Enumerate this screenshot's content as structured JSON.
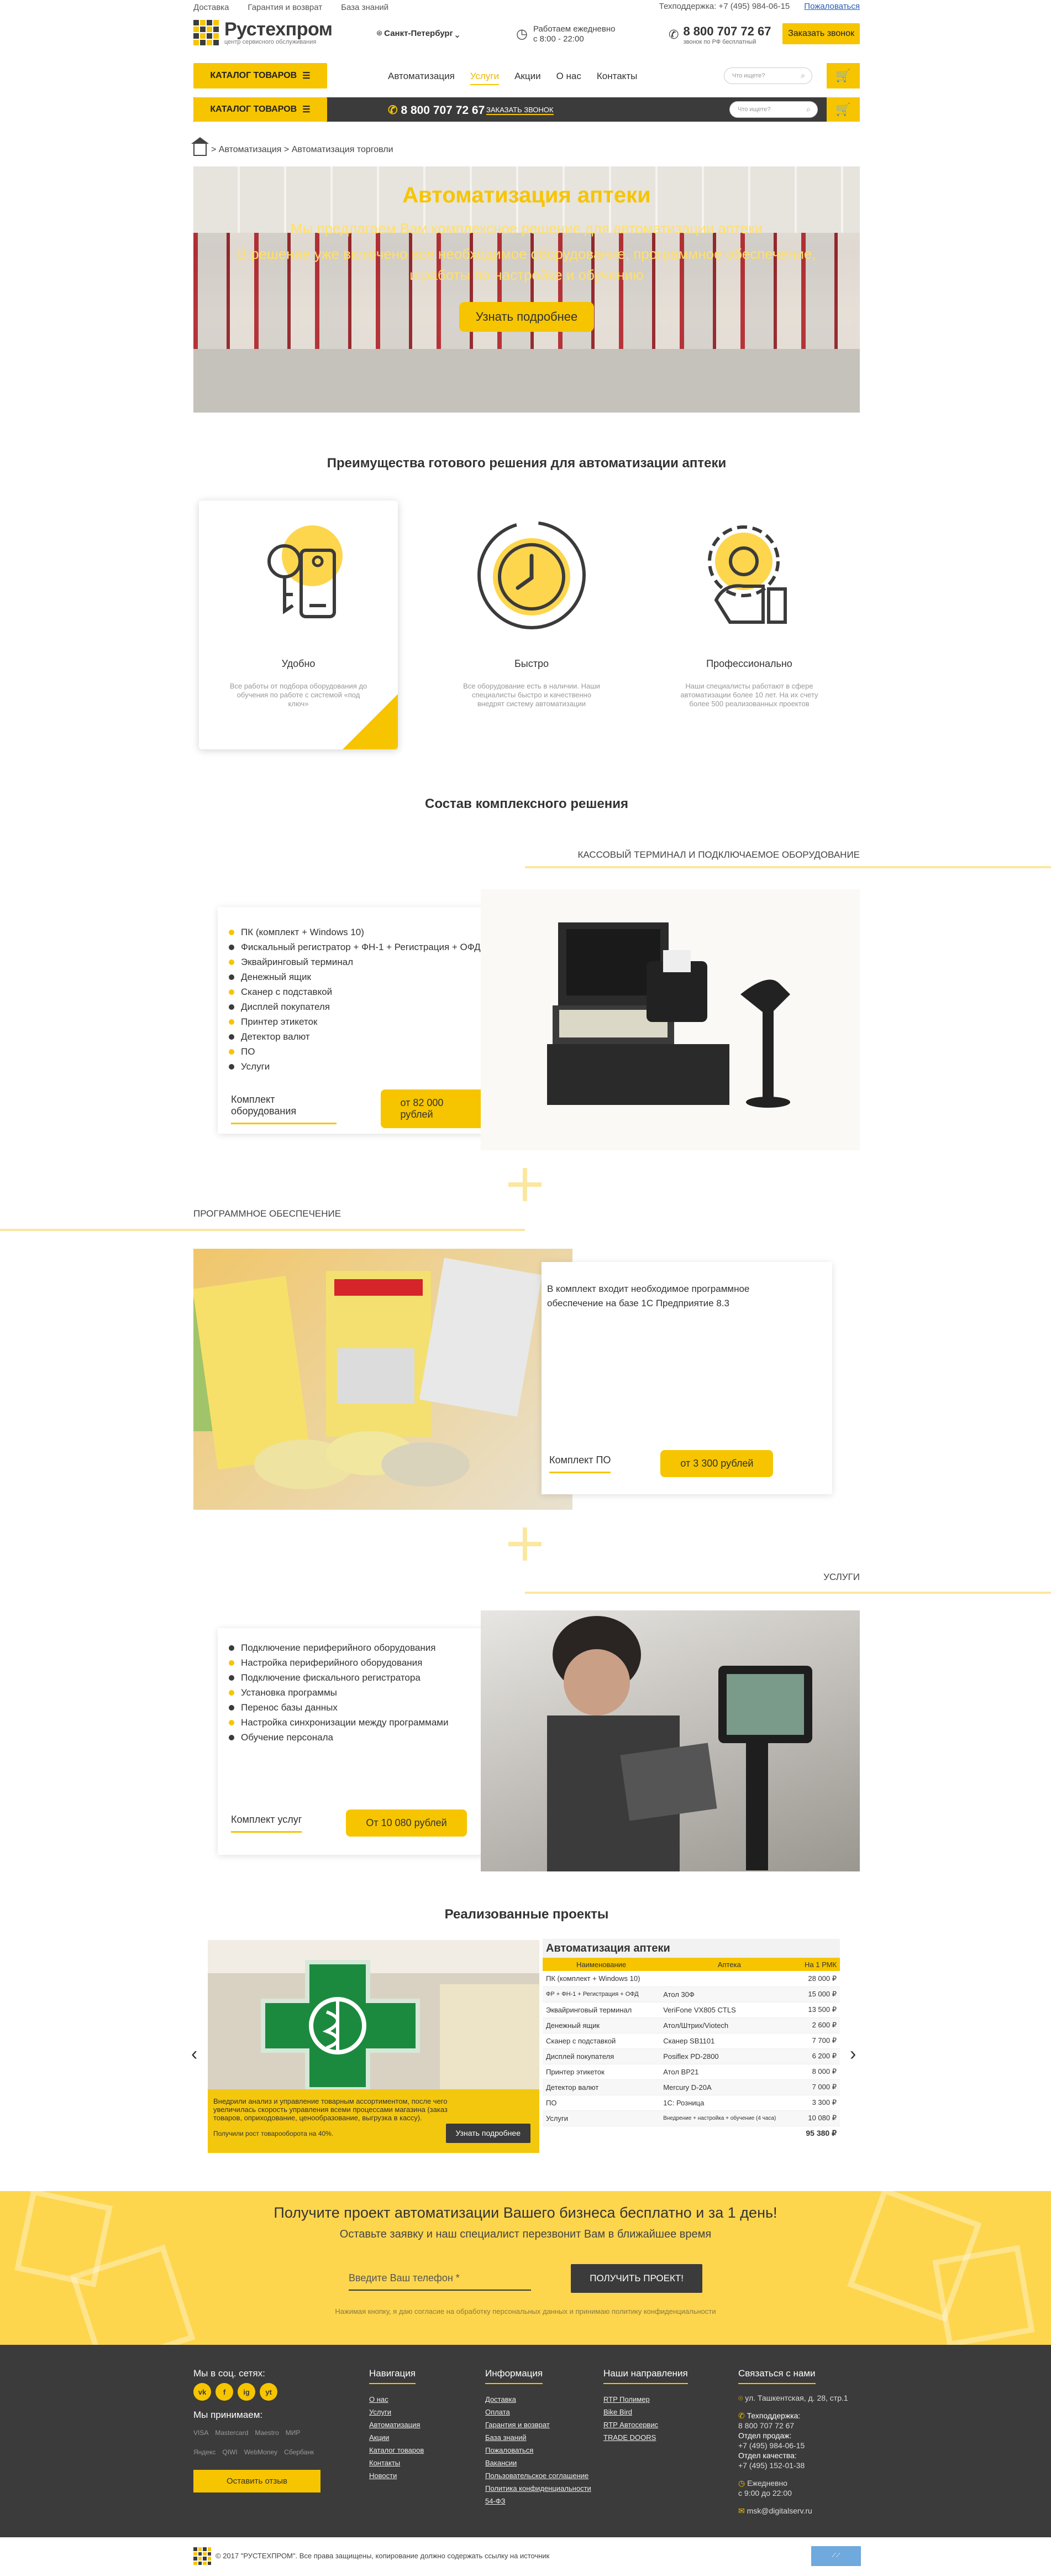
{
  "topbar": {
    "links": [
      "Доставка",
      "Гарантия и возврат",
      "База знаний"
    ],
    "support": "Техподдержка: +7 (495) 984-06-15",
    "complain": "Пожаловаться"
  },
  "header": {
    "logo_name": "Рустехпром",
    "logo_tagline": "центр сервисного обслуживания",
    "city": "Санкт-Петербург",
    "hours_line1": "Работаем ежедневно",
    "hours_line2": "с 8:00 - 22:00",
    "phone": "8 800 707 72 67",
    "phone_note": "звонок по РФ бесплатный",
    "callback": "Заказать звонок"
  },
  "nav": {
    "catalog": "КАТАЛОГ ТОВАРОВ",
    "items": [
      "Автоматизация",
      "Услуги",
      "Акции",
      "О нас",
      "Контакты"
    ],
    "active": "Услуги",
    "search_placeholder": "Что ищете?"
  },
  "sticky": {
    "catalog": "КАТАЛОГ ТОВАРОВ",
    "phone": "8 800 707 72 67",
    "callback": "ЗАКАЗАТЬ ЗВОНОК",
    "search_placeholder": "Что ищете?"
  },
  "breadcrumb": "> Автоматизация > Автоматизация торговли",
  "hero": {
    "title": "Автоматизация аптеки",
    "line1": "Мы предлагаем Вам комплексное решение для автоматизации аптеки",
    "line2": "В решение уже включено все необходимое оборудование, программное обеспечение,",
    "line3": "и работы по настройке и обучению",
    "button": "Узнать подробнее"
  },
  "advantages": {
    "title": "Преимущества готового решения для автоматизации аптеки",
    "items": [
      {
        "title": "Удобно",
        "text": "Все работы от подбора оборудования до обучения по работе с системой «под ключ»"
      },
      {
        "title": "Быстро",
        "text": "Все оборудование есть в наличии. Наши специалисты быстро и качественно внедрят систему автоматизации"
      },
      {
        "title": "Профессионально",
        "text": "Наши специалисты работают в сфере автоматизации более 10 лет. На их счету более 500 реализованных проектов"
      }
    ]
  },
  "composition": {
    "title": "Состав комплексного решения",
    "hardware": {
      "label": "КАССОВЫЙ ТЕРМИНАЛ И ПОДКЛЮЧАЕМОЕ ОБОРУДОВАНИЕ",
      "items": [
        "ПК (комплект + Windows 10)",
        "Фискальный регистратор + ФН-1 + Регистрация + ОФД",
        "Эквайринговый терминал",
        "Денежный ящик",
        "Сканер с подставкой",
        "Дисплей покупателя",
        "Принтер этикеток",
        "Детектор валют",
        "ПО",
        "Услуги"
      ],
      "footer": "Комплект оборудования",
      "price": "от 82 000 рублей"
    },
    "software": {
      "label": "ПРОГРАММНОЕ ОБЕСПЕЧЕНИЕ",
      "text": "В комплект входит необходимое программное обеспечение на базе 1С Предприятие 8.3",
      "footer": "Комплект ПО",
      "price": "от 3 300 рублей"
    },
    "services": {
      "label": "УСЛУГИ",
      "items": [
        "Подключение периферийного оборудования",
        "Настройка периферийного оборудования",
        "Подключение фискального регистратора",
        "Установка программы",
        "Перенос базы данных",
        "Настройка синхронизации между программами",
        "Обучение персонала"
      ],
      "footer": "Комплект услуг",
      "price": "От 10 080 рублей"
    }
  },
  "projects": {
    "title": "Реализованные проекты",
    "note": "Внедрили анализ и управление товарным ассортиментом, после чего увеличилась скорость управления всеми процессами магазина (заказ товаров, оприходование, ценообразование, выгрузка в кассу).",
    "note_result": "Получили рост товарооборота на 40%.",
    "button": "Узнать подробнее",
    "table_title": "Автоматизация аптеки",
    "columns": [
      "Наименование",
      "Аптека",
      "На 1 РМК"
    ],
    "rows": [
      [
        "ПК (комплект + Windows 10)",
        "",
        "28 000 ₽"
      ],
      [
        "ФР + ФН-1 + Регистрация + ОФД",
        "Атол 30Ф",
        "15 000 ₽"
      ],
      [
        "Эквайринговый терминал",
        "VeriFone VX805 CTLS",
        "13 500 ₽"
      ],
      [
        "Денежный ящик",
        "Атол/Штрих/Viotech",
        "2 600 ₽"
      ],
      [
        "Сканер с подставкой",
        "Сканер SB1101",
        "7 700 ₽"
      ],
      [
        "Дисплей покупателя",
        "Posiflex PD-2800",
        "6 200 ₽"
      ],
      [
        "Принтер этикеток",
        "Атол BP21",
        "8 000 ₽"
      ],
      [
        "Детектор валют",
        "Mercury D-20A",
        "7 000 ₽"
      ],
      [
        "ПО",
        "1С: Розница",
        "3 300 ₽"
      ],
      [
        "Услуги",
        "Внедрение + настройка + обучение (4 часа)",
        "10 080 ₽"
      ]
    ],
    "total": "95 380 ₽"
  },
  "cta": {
    "title": "Получите проект автоматизации Вашего бизнеса бесплатно и за 1 день!",
    "subtitle": "Оставьте заявку и наш специалист перезвонит Вам в ближайшее время",
    "placeholder": "Введите Ваш телефон *",
    "button": "ПОЛУЧИТЬ ПРОЕКТ!",
    "agree": "Нажимая кнопку, я даю согласие на обработку персональных данных и принимаю политику конфиденциальности"
  },
  "footer": {
    "social_title": "Мы в соц. сетях:",
    "social": [
      "vk",
      "f",
      "ig",
      "yt"
    ],
    "pay_title": "Мы принимаем:",
    "pay": [
      "VISA",
      "Mastercard",
      "Maestro",
      "МИР",
      "Яндекс",
      "QIWI",
      "WebMoney",
      "Сбербанк"
    ],
    "review": "Оставить отзыв",
    "nav_title": "Навигация",
    "nav": [
      "О нас",
      "Услуги",
      "Автоматизация",
      "Акции",
      "Каталог товаров",
      "Контакты",
      "Новости"
    ],
    "info_title": "Информация",
    "info": [
      "Доставка",
      "Оплата",
      "Гарантия и возврат",
      "База знаний",
      "Пожаловаться",
      "Вакансии",
      "Пользовательское соглашение",
      "Политика конфиденциальности",
      "54-ФЗ"
    ],
    "dir_title": "Наши направления",
    "dir": [
      "RTP Полимер",
      "Bike Bird",
      "RTP Автосервис",
      "TRADE DOORS"
    ],
    "contacts_title": "Связаться с нами",
    "address": "ул. Ташкентская, д. 28, стр.1",
    "support_label": "Техподдержка:",
    "support_phone": "8 800 707 72 67",
    "sales_label": "Отдел продаж:",
    "sales_phone": "+7 (495) 984-06-15",
    "quality_label": "Отдел качества:",
    "quality_phone": "+7 (495) 152-01-38",
    "daily": "Ежедневно",
    "daily_hours": "с 9:00 до 22:00",
    "email": "msk@digitalserv.ru"
  },
  "bottom": {
    "copyright": "© 2017 \"РУСТЕХПРОМ\". Все права защищены, копирование должно содержать ссылку на источник"
  }
}
